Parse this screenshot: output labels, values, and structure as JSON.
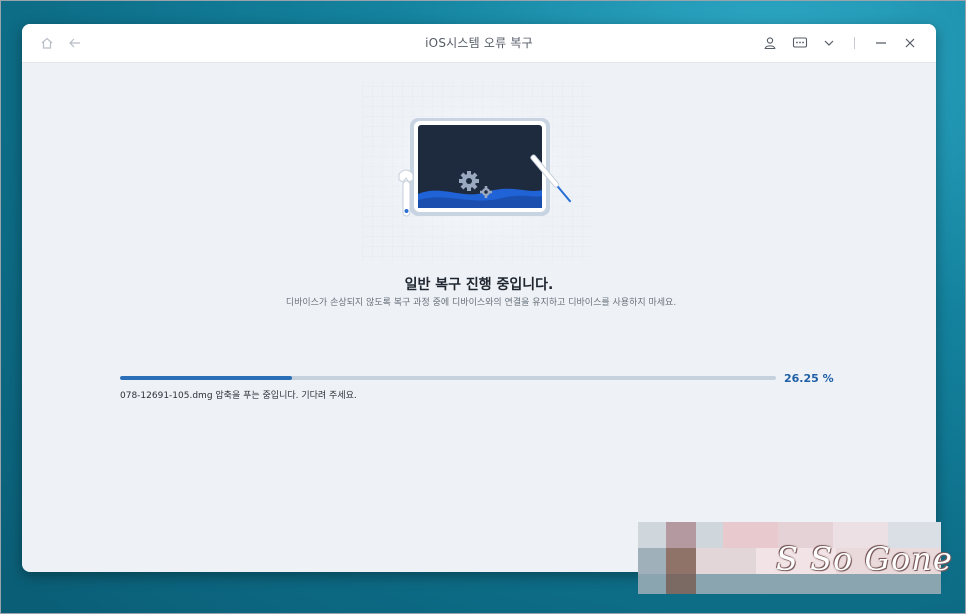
{
  "window": {
    "title": "iOS시스템 오류 복구"
  },
  "titlebar_icons": [
    "home-icon",
    "back-arrow-icon",
    "user-icon",
    "feedback-icon",
    "chevron-down-icon",
    "minimize-icon",
    "close-icon"
  ],
  "main": {
    "heading": "일반 복구 진행 중입니다.",
    "description": "디바이스가 손상되지 않도록 복구 과정 중에 디바이스와의 연결을 유지하고 디바이스를 사용하지 마세요.",
    "progress": {
      "percent_value": 26.25,
      "percent_label": "26.25 %",
      "status_text": "078-12691-105.dmg 압축을 푸는 중입니다. 기다려 주세요."
    }
  },
  "watermark": {
    "text": "S So Gone"
  },
  "colors": {
    "accent": "#2a6fb8",
    "background_window": "#eef2f7",
    "illustration_screen": "#1e2a3e"
  }
}
